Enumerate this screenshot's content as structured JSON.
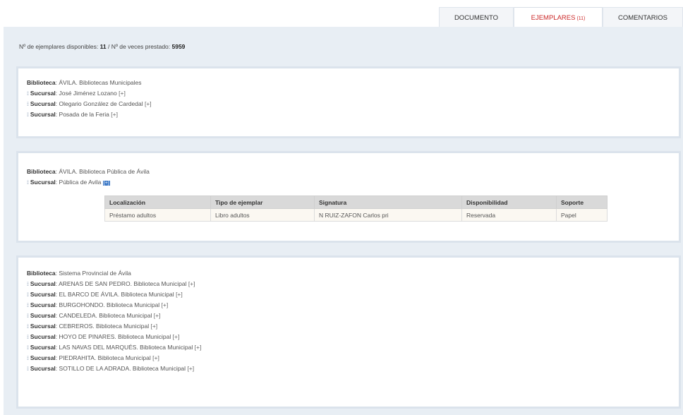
{
  "tabs": [
    {
      "label": "DOCUMENTO"
    },
    {
      "label": "EJEMPLARES",
      "count": "(11)"
    },
    {
      "label": "COMENTARIOS"
    }
  ],
  "summary": {
    "available_label": "Nº de ejemplares disponibles: ",
    "available_value": "11",
    "separator": " / ",
    "loaned_label": "Nº de veces prestado: ",
    "loaned_value": "5959"
  },
  "library_label": "Biblioteca",
  "branch_label": "Sucursal",
  "expand_label": "[+]",
  "libraries": [
    {
      "name": "ÁVILA. Bibliotecas Municipales",
      "branches": [
        "José Jiménez Lozano",
        "Olegario González de Cardedal",
        "Posada de la Feria"
      ]
    },
    {
      "name": "ÁVILA. Biblioteca Pública de Ávila",
      "branches": [
        "Pública de Avila"
      ],
      "table": {
        "headers": [
          "Localización",
          "Tipo de ejemplar",
          "Signatura",
          "Disponibilidad",
          "Soporte"
        ],
        "rows": [
          [
            "Préstamo adultos",
            "Libro adultos",
            "N RUIZ-ZAFON Carlos pri",
            "Reservada",
            "Papel"
          ]
        ]
      }
    },
    {
      "name": "Sistema Provincial de Ávila",
      "branches": [
        "ARENAS DE SAN PEDRO. Biblioteca Municipal",
        "EL BARCO DE ÁVILA. Biblioteca Municipal",
        "BURGOHONDO. Biblioteca Municipal",
        "CANDELEDA. Biblioteca Municipal",
        "CEBREROS. Biblioteca Municipal",
        "HOYO DE PINARES. Biblioteca Municipal",
        "LAS NAVAS DEL MARQUÉS. Biblioteca Municipal",
        "PIEDRAHITA. Biblioteca Municipal",
        "SOTILLO DE LA ADRADA. Biblioteca Municipal"
      ]
    }
  ]
}
